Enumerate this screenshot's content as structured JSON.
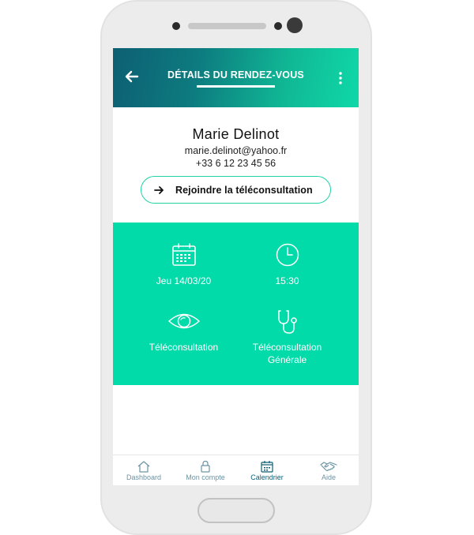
{
  "header": {
    "title": "DÉTAILS DU RENDEZ-VOUS",
    "back_icon": "arrow-left-icon",
    "more_icon": "more-vertical-icon"
  },
  "patient": {
    "name": "Marie Delinot",
    "email": "marie.delinot@yahoo.fr",
    "phone": "+33 6 12 23 45 56"
  },
  "join_button": {
    "label": "Rejoindre la téléconsultation",
    "icon": "arrow-right-icon"
  },
  "appointment": {
    "date": "Jeu 14/03/20",
    "time": "15:30",
    "type": "Téléconsultation",
    "specialty_line1": "Téléconsultation",
    "specialty_line2": "Générale"
  },
  "tabs": [
    {
      "label": "Dashboard",
      "icon": "home-icon"
    },
    {
      "label": "Mon compte",
      "icon": "lock-icon"
    },
    {
      "label": "Calendrier",
      "icon": "calendar-icon"
    },
    {
      "label": "Aide",
      "icon": "handshake-icon"
    }
  ],
  "active_tab": "Calendrier",
  "colors": {
    "header_start": "#0d5f72",
    "header_end": "#0fd8a8",
    "accent": "#00dba9",
    "tab_label": "#6c93a4"
  }
}
